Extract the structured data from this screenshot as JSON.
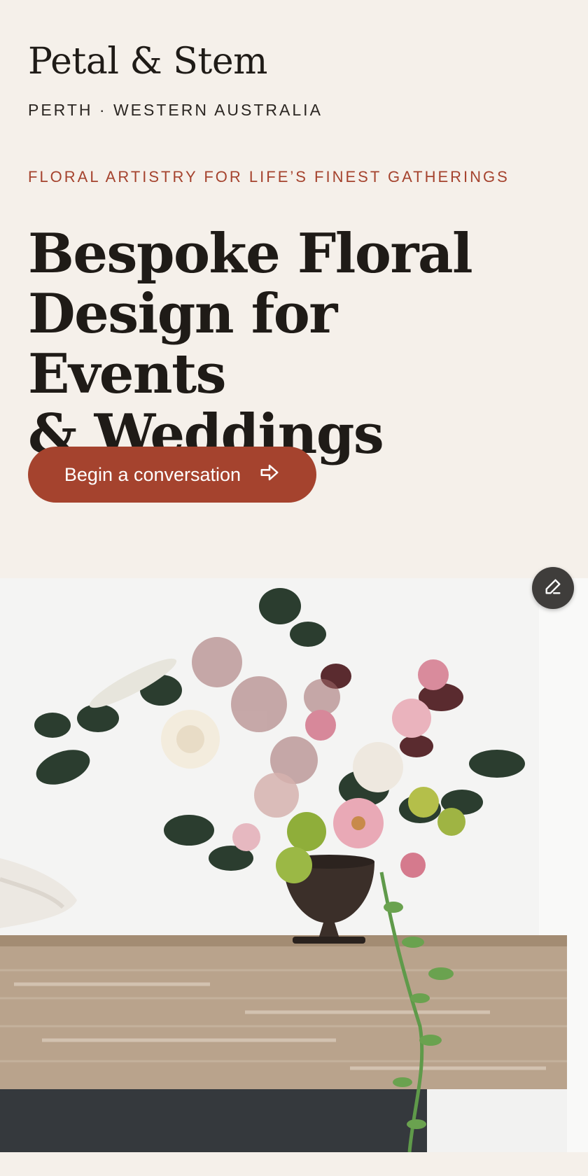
{
  "header": {
    "brand": "Petal & Stem",
    "location": "PERTH · WESTERN AUSTRALIA"
  },
  "hero": {
    "tagline": "FLORAL ARTISTRY FOR LIFE’S FINEST GATHERINGS",
    "headline_lines": [
      "Bespoke Floral",
      "Design for Events",
      "& Weddings"
    ],
    "cta_label": "Begin a conversation",
    "cta_icon": "arrow-right-icon",
    "image_subject": "floral-arrangement-photo"
  },
  "edit_button": {
    "icon": "pencil-icon"
  },
  "colors": {
    "background": "#f5f0ea",
    "text": "#1f1b17",
    "accent": "#a5432e",
    "edit_button": "#3f3d3b"
  }
}
